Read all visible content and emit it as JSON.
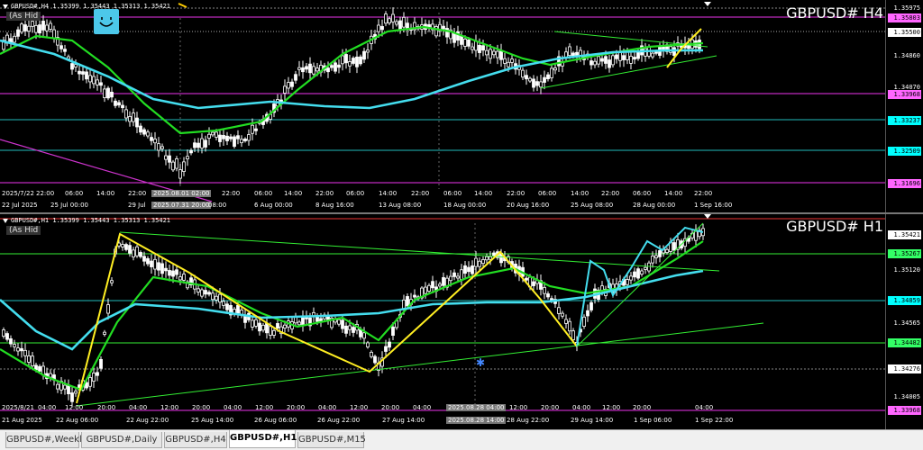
{
  "charts": {
    "h4": {
      "info": "GBPUSD#,H4  1.35399 1.35443 1.35313 1.35421",
      "as_hid": "(As Hid",
      "symbol": "GBPUSD# H4",
      "prices": [
        {
          "label": "1.35975",
          "color": "#ffffff",
          "bg": "#000000"
        },
        {
          "label": "1.35803",
          "color": "#000000",
          "bg": "#ff66ff"
        },
        {
          "label": "1.35500",
          "color": "#000000",
          "bg": "#ffffff"
        },
        {
          "label": "1.34860",
          "color": "#ffffff",
          "bg": "#000000"
        },
        {
          "label": "1.34070",
          "color": "#ffffff",
          "bg": "#000000"
        },
        {
          "label": "1.33968",
          "color": "#000000",
          "bg": "#ff66ff"
        },
        {
          "label": "1.33237",
          "color": "#000000",
          "bg": "#00ffff"
        },
        {
          "label": "1.32509",
          "color": "#000000",
          "bg": "#00ffff"
        },
        {
          "label": "1.31696",
          "color": "#000000",
          "bg": "#ff66ff"
        }
      ],
      "times": [
        {
          "label": "2025/7/22",
          "sel": false
        },
        {
          "label": "22:00",
          "sel": false
        },
        {
          "label": "06:00",
          "sel": false
        },
        {
          "label": "14:00",
          "sel": false
        },
        {
          "label": "22:00",
          "sel": false
        },
        {
          "label": "2025.08.01 02:00",
          "sel": true
        },
        {
          "label": "22:00",
          "sel": false
        },
        {
          "label": "06:00",
          "sel": false
        },
        {
          "label": "14:00",
          "sel": false
        },
        {
          "label": "22:00",
          "sel": false
        },
        {
          "label": "06:00",
          "sel": false
        },
        {
          "label": "14:00",
          "sel": false
        },
        {
          "label": "22:00",
          "sel": false
        },
        {
          "label": "06:00",
          "sel": false
        },
        {
          "label": "14:00",
          "sel": false
        },
        {
          "label": "22:00",
          "sel": false
        },
        {
          "label": "06:00",
          "sel": false
        },
        {
          "label": "14:00",
          "sel": false
        },
        {
          "label": "22:00",
          "sel": false
        },
        {
          "label": "06:00",
          "sel": false
        },
        {
          "label": "14:00",
          "sel": false
        },
        {
          "label": "22:00",
          "sel": false
        }
      ],
      "dates": [
        {
          "label": "22 Jul 2025",
          "sel": false
        },
        {
          "label": "25 Jul 00:00",
          "sel": false
        },
        {
          "label": "29 Jul",
          "sel": false
        },
        {
          "label": "2025.07.31 20:00",
          "sel": true
        },
        {
          "label": "08:00",
          "sel": false
        },
        {
          "label": "6 Aug 00:00",
          "sel": false
        },
        {
          "label": "8 Aug 16:00",
          "sel": false
        },
        {
          "label": "13 Aug 08:00",
          "sel": false
        },
        {
          "label": "18 Aug 00:00",
          "sel": false
        },
        {
          "label": "20 Aug 16:00",
          "sel": false
        },
        {
          "label": "25 Aug 08:00",
          "sel": false
        },
        {
          "label": "28 Aug 00:00",
          "sel": false
        },
        {
          "label": "1 Sep 16:00",
          "sel": false
        }
      ]
    },
    "h1": {
      "info": "GBPUSD#,H1  1.35399 1.35443 1.35313 1.35421",
      "as_hid": "(As Hid",
      "symbol": "GBPUSD# H1",
      "prices": [
        {
          "label": "1.35421",
          "color": "#000000",
          "bg": "#ffffff"
        },
        {
          "label": "1.35267",
          "color": "#000000",
          "bg": "#33ff66"
        },
        {
          "label": "1.35120",
          "color": "#ffffff",
          "bg": "#000000"
        },
        {
          "label": "1.34859",
          "color": "#000000",
          "bg": "#00ffff"
        },
        {
          "label": "1.34565",
          "color": "#ffffff",
          "bg": "#000000"
        },
        {
          "label": "1.34482",
          "color": "#000000",
          "bg": "#33ff66"
        },
        {
          "label": "1.34276",
          "color": "#000000",
          "bg": "#ffffff"
        },
        {
          "label": "1.34005",
          "color": "#ffffff",
          "bg": "#000000"
        },
        {
          "label": "1.33968",
          "color": "#000000",
          "bg": "#ff66ff"
        }
      ],
      "times": [
        {
          "label": "2025/8/21",
          "sel": false
        },
        {
          "label": "04:00",
          "sel": false
        },
        {
          "label": "12:00",
          "sel": false
        },
        {
          "label": "20:00",
          "sel": false
        },
        {
          "label": "04:00",
          "sel": false
        },
        {
          "label": "12:00",
          "sel": false
        },
        {
          "label": "20:00",
          "sel": false
        },
        {
          "label": "04:00",
          "sel": false
        },
        {
          "label": "12:00",
          "sel": false
        },
        {
          "label": "20:00",
          "sel": false
        },
        {
          "label": "04:00",
          "sel": false
        },
        {
          "label": "12:00",
          "sel": false
        },
        {
          "label": "20:00",
          "sel": false
        },
        {
          "label": "04:00",
          "sel": false
        },
        {
          "label": "2025.08.28 04:00",
          "sel": true
        },
        {
          "label": "12:00",
          "sel": false
        },
        {
          "label": "20:00",
          "sel": false
        },
        {
          "label": "04:00",
          "sel": false
        },
        {
          "label": "12:00",
          "sel": false
        },
        {
          "label": "20:00",
          "sel": false
        },
        {
          "label": "04:00",
          "sel": false
        }
      ],
      "dates": [
        {
          "label": "21 Aug 2025",
          "sel": false
        },
        {
          "label": "22 Aug 06:00",
          "sel": false
        },
        {
          "label": "22 Aug 22:00",
          "sel": false
        },
        {
          "label": "25 Aug 14:00",
          "sel": false
        },
        {
          "label": "26 Aug 06:00",
          "sel": false
        },
        {
          "label": "26 Aug 22:00",
          "sel": false
        },
        {
          "label": "27 Aug 14:00",
          "sel": false
        },
        {
          "label": "2025.08.28 14:00",
          "sel": true
        },
        {
          "label": "28 Aug 22:00",
          "sel": false
        },
        {
          "label": "29 Aug 14:00",
          "sel": false
        },
        {
          "label": "1 Sep 06:00",
          "sel": false
        },
        {
          "label": "1 Sep 22:00",
          "sel": false
        }
      ]
    }
  },
  "tabs": [
    {
      "label": "GBPUSD#,Weekly",
      "active": false
    },
    {
      "label": "GBPUSD#,Daily",
      "active": false
    },
    {
      "label": "GBPUSD#,H4",
      "active": false
    },
    {
      "label": "GBPUSD#,H1",
      "active": true
    },
    {
      "label": "GBPUSD#,M15",
      "active": false
    }
  ],
  "colors": {
    "candle": "#ffffff",
    "ma_fast": "#22dd22",
    "ma_slow": "#44ddee",
    "zigzag": "#ffee22",
    "trend_line": "#33ee33",
    "support_magenta": "#ee33ee"
  }
}
